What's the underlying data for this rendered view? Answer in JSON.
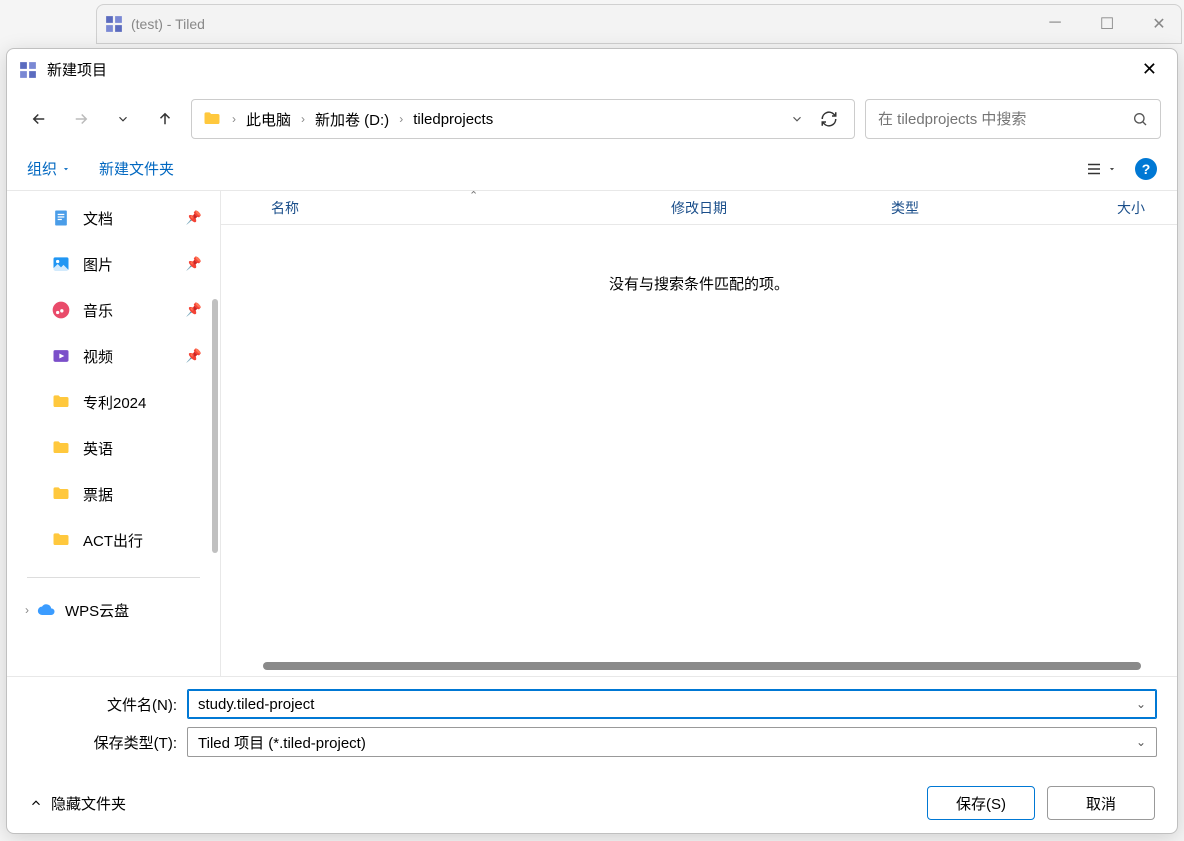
{
  "parent_window": {
    "title": "(test) - Tiled"
  },
  "dialog": {
    "title": "新建项目",
    "breadcrumbs": [
      "此电脑",
      "新加卷 (D:)",
      "tiledprojects"
    ],
    "search_placeholder": "在 tiledprojects 中搜索",
    "toolbar": {
      "organize": "组织",
      "new_folder": "新建文件夹"
    },
    "sidebar": {
      "items": [
        {
          "label": "文档",
          "pinned": true,
          "icon": "doc"
        },
        {
          "label": "图片",
          "pinned": true,
          "icon": "pic"
        },
        {
          "label": "音乐",
          "pinned": true,
          "icon": "music"
        },
        {
          "label": "视频",
          "pinned": true,
          "icon": "video"
        },
        {
          "label": "专利2024",
          "pinned": false,
          "icon": "folder"
        },
        {
          "label": "英语",
          "pinned": false,
          "icon": "folder"
        },
        {
          "label": "票据",
          "pinned": false,
          "icon": "folder"
        },
        {
          "label": "ACT出行",
          "pinned": false,
          "icon": "folder"
        }
      ],
      "cloud": "WPS云盘"
    },
    "columns": {
      "name": "名称",
      "date": "修改日期",
      "type": "类型",
      "size": "大小"
    },
    "empty_message": "没有与搜索条件匹配的项。",
    "filename_label": "文件名(N):",
    "filename_value": "study.tiled-project",
    "filetype_label": "保存类型(T):",
    "filetype_value": "Tiled 项目 (*.tiled-project)",
    "hide_folders": "隐藏文件夹",
    "save_button": "保存(S)",
    "cancel_button": "取消"
  }
}
